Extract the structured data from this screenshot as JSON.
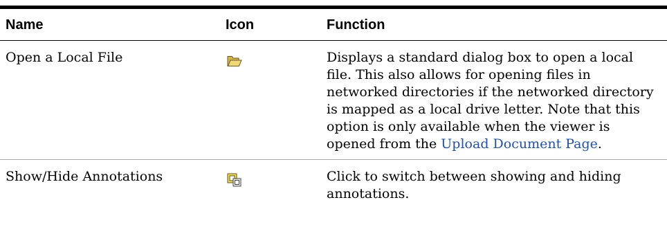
{
  "table": {
    "headers": {
      "name": "Name",
      "icon": "Icon",
      "function": "Function"
    },
    "rows": [
      {
        "name": "Open a Local File",
        "icon": "folder-open-icon",
        "function_text": "Displays a standard dialog box to open a local file. This also allows for opening files in networked directories if the networked directory is mapped as a local drive letter. Note that this option is only available when the viewer is opened from the ",
        "function_link": "Upload Document Page",
        "function_tail": "."
      },
      {
        "name": "Show/Hide Annotations",
        "icon": "show-hide-annotations-icon",
        "function_text": "Click to switch between showing and hiding annotations."
      }
    ]
  },
  "colors": {
    "link": "#1f4fb4",
    "folder_fill": "#e3c85a",
    "annotation_fill": "#f2e24a"
  }
}
